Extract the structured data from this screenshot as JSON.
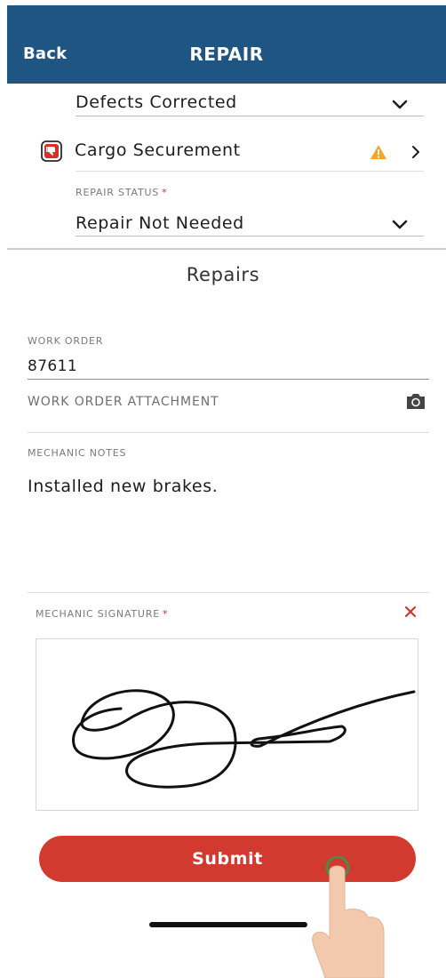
{
  "header": {
    "back_label": "Back",
    "title": "REPAIR"
  },
  "defect_status": {
    "value": "Defects Corrected"
  },
  "cargo_item": {
    "label": "Cargo Securement",
    "icon": "thumbs-down-icon",
    "warning_icon": "warning-icon",
    "chevron": "chevron-right-icon"
  },
  "repair_status": {
    "label": "REPAIR STATUS",
    "required": "*",
    "value": "Repair Not Needed"
  },
  "repairs_section": {
    "title": "Repairs",
    "work_order_label": "WORK ORDER",
    "work_order_value": "87611",
    "attachment_label": "WORK ORDER ATTACHMENT",
    "attachment_icon": "camera-icon",
    "notes_label": "MECHANIC NOTES",
    "notes_value": "Installed new brakes.",
    "signature_label": "MECHANIC SIGNATURE",
    "signature_required": "*",
    "signature_clear_icon": "close-icon"
  },
  "submit": {
    "label": "Submit"
  },
  "colors": {
    "header_bg": "#1f5583",
    "primary_button": "#d23a30",
    "warning": "#f5a623",
    "required": "#d32f2f"
  }
}
